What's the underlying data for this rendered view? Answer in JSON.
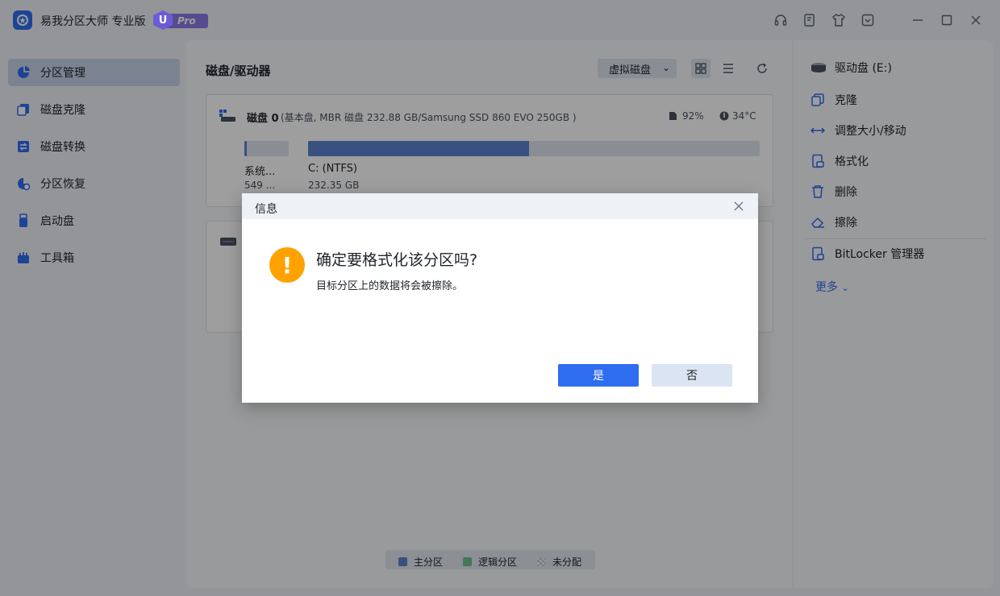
{
  "app": {
    "title": "易我分区大师 专业版",
    "badge_letter": "U",
    "badge_text": "Pro"
  },
  "titlebar_icons": [
    "headset-icon",
    "feedback-icon",
    "shirt-icon",
    "dropdown-menu-icon",
    "minimize-icon",
    "maximize-icon",
    "close-icon"
  ],
  "sidebar": {
    "items": [
      {
        "label": "分区管理",
        "active": true
      },
      {
        "label": "磁盘克隆",
        "active": false
      },
      {
        "label": "磁盘转换",
        "active": false
      },
      {
        "label": "分区恢复",
        "active": false
      },
      {
        "label": "启动盘",
        "active": false
      },
      {
        "label": "工具箱",
        "active": false
      }
    ]
  },
  "main": {
    "title": "磁盘/驱动器",
    "virtual_disk_label": "虚拟磁盘",
    "disk0": {
      "name": "磁盘 0",
      "info": "(基本盘, MBR 磁盘 232.88 GB/Samsung SSD 860 EVO 250GB )",
      "health": "92%",
      "temperature": "34°C",
      "partitions": [
        {
          "label": "系统...",
          "size": "549 ...",
          "used_fraction": 0.06
        },
        {
          "label": "C: (NTFS)",
          "size": "232.35 GB",
          "used_fraction": 0.49
        }
      ]
    }
  },
  "right_panel": {
    "drive_label": "驱动盘 (E:)",
    "actions": [
      "克隆",
      "调整大小/移动",
      "格式化",
      "删除",
      "擦除"
    ],
    "bitlocker": "BitLocker 管理器",
    "more": "更多"
  },
  "legend": {
    "primary": "主分区",
    "logical": "逻辑分区",
    "unallocated": "未分配",
    "colors": {
      "primary": "#5b84d1",
      "logical": "#6fbf8e",
      "unallocated": "#c9cdd4"
    }
  },
  "dialog": {
    "title": "信息",
    "question": "确定要格式化该分区吗?",
    "detail": "目标分区上的数据将会被擦除。",
    "yes_label": "是",
    "no_label": "否"
  },
  "colors": {
    "accent": "#2f6df0",
    "warning": "#ffa200"
  }
}
